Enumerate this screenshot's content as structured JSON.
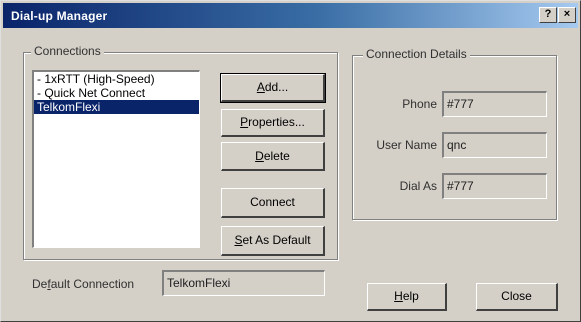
{
  "window": {
    "title": "Dial-up Manager",
    "help_glyph": "?",
    "close_glyph": "×"
  },
  "connections": {
    "group_label": "Connections",
    "items": [
      {
        "label": "- 1xRTT (High-Speed)",
        "selected": false
      },
      {
        "label": "- Quick Net Connect",
        "selected": false
      },
      {
        "label": "TelkomFlexi",
        "selected": true
      }
    ]
  },
  "buttons": {
    "add": {
      "pre": "",
      "mnemonic": "A",
      "post": "dd..."
    },
    "properties": {
      "pre": "",
      "mnemonic": "P",
      "post": "roperties..."
    },
    "delete": {
      "pre": "",
      "mnemonic": "D",
      "post": "elete"
    },
    "connect": {
      "label": "Connect"
    },
    "set_default": {
      "pre": "",
      "mnemonic": "S",
      "post": "et As Default"
    },
    "help": {
      "pre": "",
      "mnemonic": "H",
      "post": "elp"
    },
    "close": {
      "label": "Close"
    }
  },
  "default_connection": {
    "label_pre": "De",
    "label_mnemonic": "f",
    "label_post": "ault Connection",
    "value": "TelkomFlexi"
  },
  "details": {
    "group_label": "Connection Details",
    "phone_label": "Phone",
    "phone_value": "#777",
    "user_label": "User Name",
    "user_value": "qnc",
    "dialas_label": "Dial As",
    "dialas_value": "#777"
  }
}
